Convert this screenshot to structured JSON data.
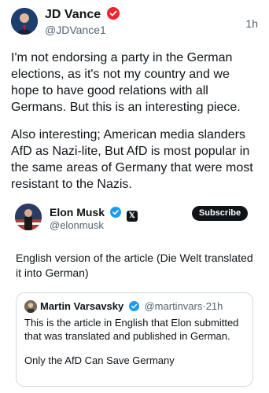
{
  "main_tweet": {
    "author_name": "JD Vance",
    "handle": "@JDVance1",
    "time": "1h",
    "paragraph1": "I'm not endorsing a party in the German elections, as it's not my country and we hope to have good relations with all Germans. But this is an interesting piece.",
    "paragraph2": "Also interesting; American media slanders AfD as Nazi-lite, But AfD is most popular in the same areas of Germany that were most resistant to the Nazis."
  },
  "quoted_tweet": {
    "author_name": "Elon Musk",
    "handle": "@elonmusk",
    "subscribe_label": "Subscribe",
    "text": "English version of the article (Die Welt translated it into German)"
  },
  "nested_quote": {
    "author_name": "Martin Varsavsky",
    "handle": "@martinvars",
    "separator": "·",
    "time": "21h",
    "text": "This is the article in English that Elon submitted that was translated and published in German.",
    "article_title": "Only the AfD Can Save Germany"
  },
  "colors": {
    "verified_badge": "#1d9bf0",
    "secondary_text": "#536471",
    "subscribe_bg": "#0f1419"
  },
  "icons": {
    "verified": "verified-badge-icon",
    "x_affiliation": "x-logo-icon"
  }
}
